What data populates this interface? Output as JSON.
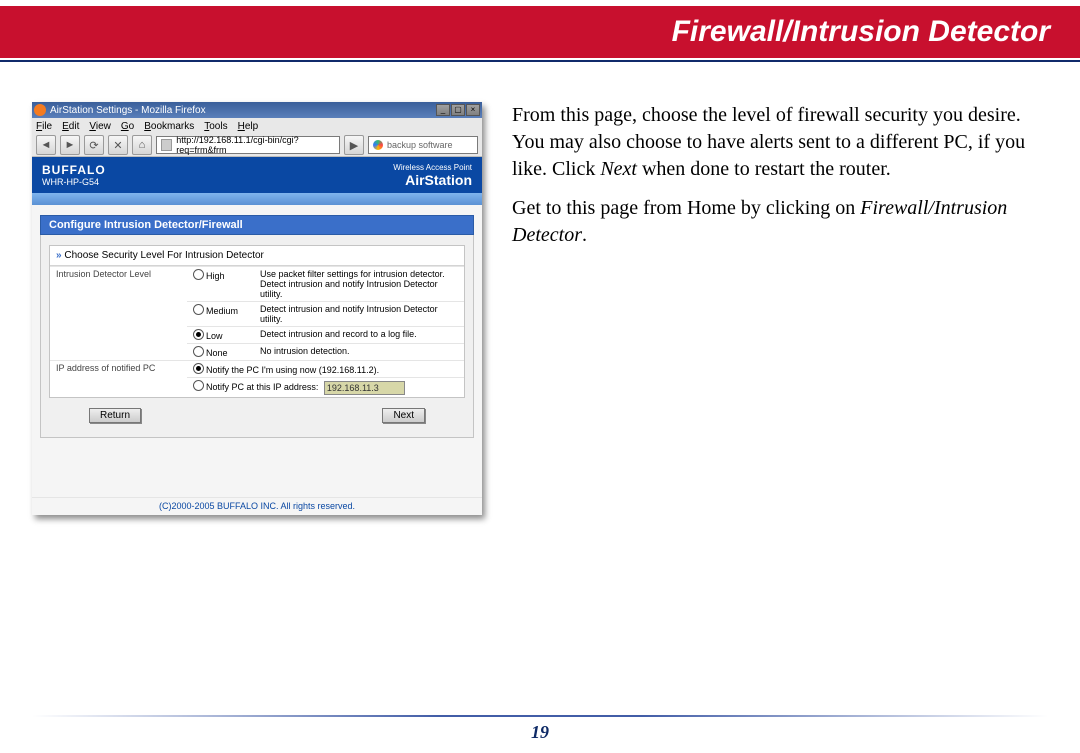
{
  "header": {
    "title": "Firewall/Intrusion Detector"
  },
  "body": {
    "para1_a": "From this page, choose the level of firewall security you desire.   You may also choose to have alerts sent to a different PC, if you like.  Click ",
    "para1_next": "Next",
    "para1_b": " when done to restart the router.",
    "para2_a": "Get to this page from Home by clicking on ",
    "para2_link": "Firewall/Intrusion Detector",
    "para2_b": "."
  },
  "page_number": "19",
  "screenshot": {
    "window_title": "AirStation Settings - Mozilla Firefox",
    "menus": [
      "File",
      "Edit",
      "View",
      "Go",
      "Bookmarks",
      "Tools",
      "Help"
    ],
    "url": "http://192.168.11.1/cgi-bin/cgi?req=frm&frm",
    "search_placeholder": "backup software",
    "brand": "BUFFALO",
    "model": "WHR-HP-G54",
    "logo_sub": "Wireless Access Point",
    "logo_main": "AirStation",
    "section_title": "Configure Intrusion Detector/Firewall",
    "group_title": "Choose Security Level For Intrusion Detector",
    "level_label": "Intrusion Detector Level",
    "levels": [
      {
        "name": "High",
        "desc": "Use packet filter settings for intrusion detector. Detect intrusion and notify Intrusion Detector utility."
      },
      {
        "name": "Medium",
        "desc": "Detect intrusion and notify Intrusion Detector utility."
      },
      {
        "name": "Low",
        "desc": "Detect intrusion and record to a log file."
      },
      {
        "name": "None",
        "desc": "No intrusion detection."
      }
    ],
    "level_selected": 2,
    "ip_label": "IP address of notified PC",
    "ip_opts": [
      "Notify the PC I'm using now (192.168.11.2).",
      "Notify PC at this IP address:"
    ],
    "ip_selected": 0,
    "ip_input_value": "192.168.11.3",
    "btn_return": "Return",
    "btn_next": "Next",
    "copyright": "(C)2000-2005 BUFFALO INC. All rights reserved."
  }
}
